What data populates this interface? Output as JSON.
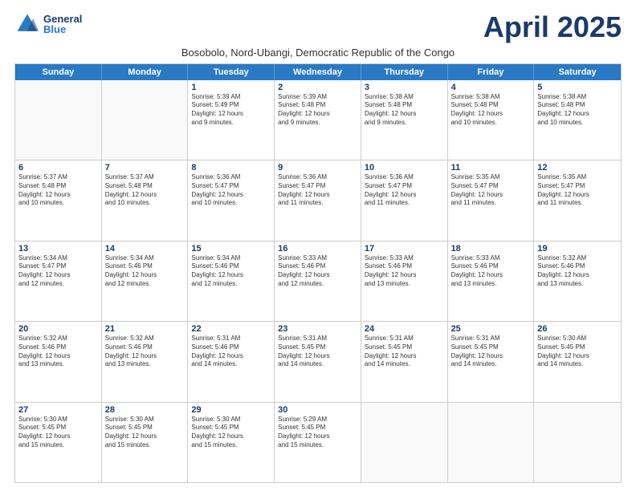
{
  "header": {
    "logo_general": "General",
    "logo_blue": "Blue",
    "month_year": "April 2025",
    "subtitle": "Bosobolo, Nord-Ubangi, Democratic Republic of the Congo"
  },
  "days_of_week": [
    "Sunday",
    "Monday",
    "Tuesday",
    "Wednesday",
    "Thursday",
    "Friday",
    "Saturday"
  ],
  "weeks": [
    [
      {
        "day": "",
        "empty": true
      },
      {
        "day": "",
        "empty": true
      },
      {
        "day": "1",
        "lines": [
          "Sunrise: 5:39 AM",
          "Sunset: 5:49 PM",
          "Daylight: 12 hours",
          "and 9 minutes."
        ]
      },
      {
        "day": "2",
        "lines": [
          "Sunrise: 5:39 AM",
          "Sunset: 5:48 PM",
          "Daylight: 12 hours",
          "and 9 minutes."
        ]
      },
      {
        "day": "3",
        "lines": [
          "Sunrise: 5:38 AM",
          "Sunset: 5:48 PM",
          "Daylight: 12 hours",
          "and 9 minutes."
        ]
      },
      {
        "day": "4",
        "lines": [
          "Sunrise: 5:38 AM",
          "Sunset: 5:48 PM",
          "Daylight: 12 hours",
          "and 10 minutes."
        ]
      },
      {
        "day": "5",
        "lines": [
          "Sunrise: 5:38 AM",
          "Sunset: 5:48 PM",
          "Daylight: 12 hours",
          "and 10 minutes."
        ]
      }
    ],
    [
      {
        "day": "6",
        "lines": [
          "Sunrise: 5:37 AM",
          "Sunset: 5:48 PM",
          "Daylight: 12 hours",
          "and 10 minutes."
        ]
      },
      {
        "day": "7",
        "lines": [
          "Sunrise: 5:37 AM",
          "Sunset: 5:48 PM",
          "Daylight: 12 hours",
          "and 10 minutes."
        ]
      },
      {
        "day": "8",
        "lines": [
          "Sunrise: 5:36 AM",
          "Sunset: 5:47 PM",
          "Daylight: 12 hours",
          "and 10 minutes."
        ]
      },
      {
        "day": "9",
        "lines": [
          "Sunrise: 5:36 AM",
          "Sunset: 5:47 PM",
          "Daylight: 12 hours",
          "and 11 minutes."
        ]
      },
      {
        "day": "10",
        "lines": [
          "Sunrise: 5:36 AM",
          "Sunset: 5:47 PM",
          "Daylight: 12 hours",
          "and 11 minutes."
        ]
      },
      {
        "day": "11",
        "lines": [
          "Sunrise: 5:35 AM",
          "Sunset: 5:47 PM",
          "Daylight: 12 hours",
          "and 11 minutes."
        ]
      },
      {
        "day": "12",
        "lines": [
          "Sunrise: 5:35 AM",
          "Sunset: 5:47 PM",
          "Daylight: 12 hours",
          "and 11 minutes."
        ]
      }
    ],
    [
      {
        "day": "13",
        "lines": [
          "Sunrise: 5:34 AM",
          "Sunset: 5:47 PM",
          "Daylight: 12 hours",
          "and 12 minutes."
        ]
      },
      {
        "day": "14",
        "lines": [
          "Sunrise: 5:34 AM",
          "Sunset: 5:46 PM",
          "Daylight: 12 hours",
          "and 12 minutes."
        ]
      },
      {
        "day": "15",
        "lines": [
          "Sunrise: 5:34 AM",
          "Sunset: 5:46 PM",
          "Daylight: 12 hours",
          "and 12 minutes."
        ]
      },
      {
        "day": "16",
        "lines": [
          "Sunrise: 5:33 AM",
          "Sunset: 5:46 PM",
          "Daylight: 12 hours",
          "and 12 minutes."
        ]
      },
      {
        "day": "17",
        "lines": [
          "Sunrise: 5:33 AM",
          "Sunset: 5:46 PM",
          "Daylight: 12 hours",
          "and 13 minutes."
        ]
      },
      {
        "day": "18",
        "lines": [
          "Sunrise: 5:33 AM",
          "Sunset: 5:46 PM",
          "Daylight: 12 hours",
          "and 13 minutes."
        ]
      },
      {
        "day": "19",
        "lines": [
          "Sunrise: 5:32 AM",
          "Sunset: 5:46 PM",
          "Daylight: 12 hours",
          "and 13 minutes."
        ]
      }
    ],
    [
      {
        "day": "20",
        "lines": [
          "Sunrise: 5:32 AM",
          "Sunset: 5:46 PM",
          "Daylight: 12 hours",
          "and 13 minutes."
        ]
      },
      {
        "day": "21",
        "lines": [
          "Sunrise: 5:32 AM",
          "Sunset: 5:46 PM",
          "Daylight: 12 hours",
          "and 13 minutes."
        ]
      },
      {
        "day": "22",
        "lines": [
          "Sunrise: 5:31 AM",
          "Sunset: 5:46 PM",
          "Daylight: 12 hours",
          "and 14 minutes."
        ]
      },
      {
        "day": "23",
        "lines": [
          "Sunrise: 5:31 AM",
          "Sunset: 5:45 PM",
          "Daylight: 12 hours",
          "and 14 minutes."
        ]
      },
      {
        "day": "24",
        "lines": [
          "Sunrise: 5:31 AM",
          "Sunset: 5:45 PM",
          "Daylight: 12 hours",
          "and 14 minutes."
        ]
      },
      {
        "day": "25",
        "lines": [
          "Sunrise: 5:31 AM",
          "Sunset: 5:45 PM",
          "Daylight: 12 hours",
          "and 14 minutes."
        ]
      },
      {
        "day": "26",
        "lines": [
          "Sunrise: 5:30 AM",
          "Sunset: 5:45 PM",
          "Daylight: 12 hours",
          "and 14 minutes."
        ]
      }
    ],
    [
      {
        "day": "27",
        "lines": [
          "Sunrise: 5:30 AM",
          "Sunset: 5:45 PM",
          "Daylight: 12 hours",
          "and 15 minutes."
        ]
      },
      {
        "day": "28",
        "lines": [
          "Sunrise: 5:30 AM",
          "Sunset: 5:45 PM",
          "Daylight: 12 hours",
          "and 15 minutes."
        ]
      },
      {
        "day": "29",
        "lines": [
          "Sunrise: 5:30 AM",
          "Sunset: 5:45 PM",
          "Daylight: 12 hours",
          "and 15 minutes."
        ]
      },
      {
        "day": "30",
        "lines": [
          "Sunrise: 5:29 AM",
          "Sunset: 5:45 PM",
          "Daylight: 12 hours",
          "and 15 minutes."
        ]
      },
      {
        "day": "",
        "empty": true
      },
      {
        "day": "",
        "empty": true
      },
      {
        "day": "",
        "empty": true
      }
    ]
  ]
}
